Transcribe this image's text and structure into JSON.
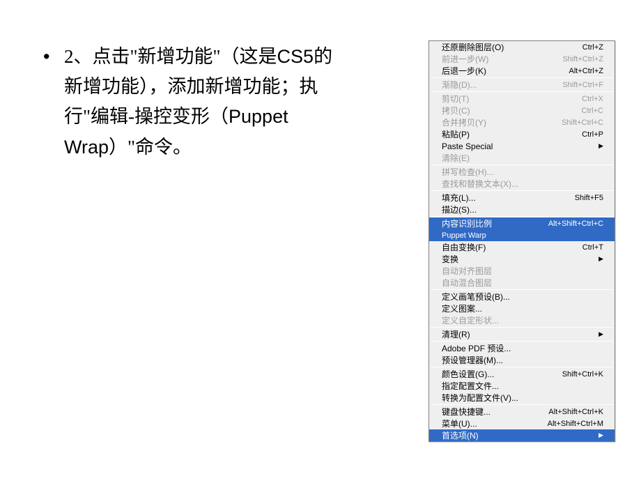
{
  "slide": {
    "bullet_marker": "•",
    "text_1": "2、点击\"新增功能\"（这是",
    "text_2": "CS5",
    "text_3": "的新增功能），添加新增功能；执行\"编辑-操控变形（",
    "text_4": "Puppet Wrap",
    "text_5": "）\"命令。"
  },
  "menu": {
    "groups": [
      [
        {
          "label": "还原删除图层(O)",
          "shortcut": "Ctrl+Z",
          "disabled": false
        },
        {
          "label": "前进一步(W)",
          "shortcut": "Shift+Ctrl+Z",
          "disabled": true
        },
        {
          "label": "后退一步(K)",
          "shortcut": "Alt+Ctrl+Z",
          "disabled": false
        }
      ],
      [
        {
          "label": "渐隐(D)...",
          "shortcut": "Shift+Ctrl+F",
          "disabled": true
        }
      ],
      [
        {
          "label": "剪切(T)",
          "shortcut": "Ctrl+X",
          "disabled": true
        },
        {
          "label": "拷贝(C)",
          "shortcut": "Ctrl+C",
          "disabled": true
        },
        {
          "label": "合并拷贝(Y)",
          "shortcut": "Shift+Ctrl+C",
          "disabled": true
        },
        {
          "label": "粘贴(P)",
          "shortcut": "Ctrl+P",
          "disabled": false
        },
        {
          "label": "Paste Special",
          "shortcut": "",
          "disabled": false,
          "arrow": true
        },
        {
          "label": "清除(E)",
          "shortcut": "",
          "disabled": true
        }
      ],
      [
        {
          "label": "拼写检查(H)...",
          "shortcut": "",
          "disabled": true
        },
        {
          "label": "查找和替换文本(X)...",
          "shortcut": "",
          "disabled": true
        }
      ],
      [
        {
          "label": "填充(L)...",
          "shortcut": "Shift+F5",
          "disabled": false
        },
        {
          "label": "描边(S)...",
          "shortcut": "",
          "disabled": false
        }
      ],
      [
        {
          "label": "内容识别比例",
          "shortcut": "Alt+Shift+Ctrl+C",
          "disabled": false,
          "hl": true
        },
        {
          "label": "Puppet Warp",
          "shortcut": "",
          "disabled": false,
          "hlpw": true
        },
        {
          "label": "自由变换(F)",
          "shortcut": "Ctrl+T",
          "disabled": false
        },
        {
          "label": "变换",
          "shortcut": "",
          "disabled": false,
          "arrow": true
        },
        {
          "label": "自动对齐图层",
          "shortcut": "",
          "disabled": true
        },
        {
          "label": "自动混合图层",
          "shortcut": "",
          "disabled": true
        }
      ],
      [
        {
          "label": "定义画笔预设(B)...",
          "shortcut": "",
          "disabled": false
        },
        {
          "label": "定义图案...",
          "shortcut": "",
          "disabled": false
        },
        {
          "label": "定义自定形状...",
          "shortcut": "",
          "disabled": true
        }
      ],
      [
        {
          "label": "清理(R)",
          "shortcut": "",
          "disabled": false,
          "arrow": true
        }
      ],
      [
        {
          "label": "Adobe PDF 预设...",
          "shortcut": "",
          "disabled": false
        },
        {
          "label": "预设管理器(M)...",
          "shortcut": "",
          "disabled": false
        }
      ],
      [
        {
          "label": "颜色设置(G)...",
          "shortcut": "Shift+Ctrl+K",
          "disabled": false
        },
        {
          "label": "指定配置文件...",
          "shortcut": "",
          "disabled": false
        },
        {
          "label": "转换为配置文件(V)...",
          "shortcut": "",
          "disabled": false
        }
      ],
      [
        {
          "label": "键盘快捷键...",
          "shortcut": "Alt+Shift+Ctrl+K",
          "disabled": false
        },
        {
          "label": "菜单(U)...",
          "shortcut": "Alt+Shift+Ctrl+M",
          "disabled": false
        },
        {
          "label": "首选项(N)",
          "shortcut": "",
          "disabled": false,
          "hl": true,
          "arrow": true
        }
      ]
    ]
  }
}
